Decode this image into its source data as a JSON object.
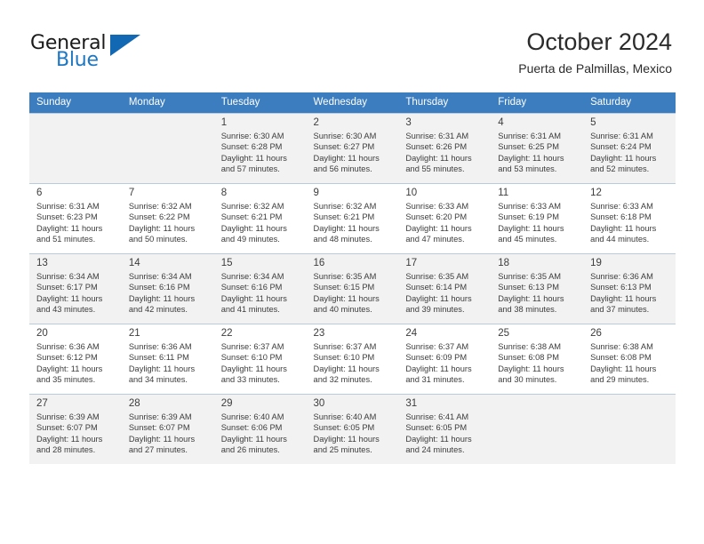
{
  "brand": {
    "name_part1": "General",
    "name_part2": "Blue",
    "triangle_color": "#1268b3",
    "blue_color": "#1f77c2"
  },
  "header": {
    "title": "October 2024",
    "subtitle": "Puerta de Palmillas, Mexico",
    "header_bg": "#3b7dbf",
    "header_text_color": "#ffffff"
  },
  "weekdays": [
    "Sunday",
    "Monday",
    "Tuesday",
    "Wednesday",
    "Thursday",
    "Friday",
    "Saturday"
  ],
  "weeks": [
    {
      "days": [
        {
          "day": "",
          "sunrise": "",
          "sunset": "",
          "daylight_line1": "",
          "daylight_line2": ""
        },
        {
          "day": "",
          "sunrise": "",
          "sunset": "",
          "daylight_line1": "",
          "daylight_line2": ""
        },
        {
          "day": "1",
          "sunrise": "Sunrise: 6:30 AM",
          "sunset": "Sunset: 6:28 PM",
          "daylight_line1": "Daylight: 11 hours",
          "daylight_line2": "and 57 minutes."
        },
        {
          "day": "2",
          "sunrise": "Sunrise: 6:30 AM",
          "sunset": "Sunset: 6:27 PM",
          "daylight_line1": "Daylight: 11 hours",
          "daylight_line2": "and 56 minutes."
        },
        {
          "day": "3",
          "sunrise": "Sunrise: 6:31 AM",
          "sunset": "Sunset: 6:26 PM",
          "daylight_line1": "Daylight: 11 hours",
          "daylight_line2": "and 55 minutes."
        },
        {
          "day": "4",
          "sunrise": "Sunrise: 6:31 AM",
          "sunset": "Sunset: 6:25 PM",
          "daylight_line1": "Daylight: 11 hours",
          "daylight_line2": "and 53 minutes."
        },
        {
          "day": "5",
          "sunrise": "Sunrise: 6:31 AM",
          "sunset": "Sunset: 6:24 PM",
          "daylight_line1": "Daylight: 11 hours",
          "daylight_line2": "and 52 minutes."
        }
      ]
    },
    {
      "days": [
        {
          "day": "6",
          "sunrise": "Sunrise: 6:31 AM",
          "sunset": "Sunset: 6:23 PM",
          "daylight_line1": "Daylight: 11 hours",
          "daylight_line2": "and 51 minutes."
        },
        {
          "day": "7",
          "sunrise": "Sunrise: 6:32 AM",
          "sunset": "Sunset: 6:22 PM",
          "daylight_line1": "Daylight: 11 hours",
          "daylight_line2": "and 50 minutes."
        },
        {
          "day": "8",
          "sunrise": "Sunrise: 6:32 AM",
          "sunset": "Sunset: 6:21 PM",
          "daylight_line1": "Daylight: 11 hours",
          "daylight_line2": "and 49 minutes."
        },
        {
          "day": "9",
          "sunrise": "Sunrise: 6:32 AM",
          "sunset": "Sunset: 6:21 PM",
          "daylight_line1": "Daylight: 11 hours",
          "daylight_line2": "and 48 minutes."
        },
        {
          "day": "10",
          "sunrise": "Sunrise: 6:33 AM",
          "sunset": "Sunset: 6:20 PM",
          "daylight_line1": "Daylight: 11 hours",
          "daylight_line2": "and 47 minutes."
        },
        {
          "day": "11",
          "sunrise": "Sunrise: 6:33 AM",
          "sunset": "Sunset: 6:19 PM",
          "daylight_line1": "Daylight: 11 hours",
          "daylight_line2": "and 45 minutes."
        },
        {
          "day": "12",
          "sunrise": "Sunrise: 6:33 AM",
          "sunset": "Sunset: 6:18 PM",
          "daylight_line1": "Daylight: 11 hours",
          "daylight_line2": "and 44 minutes."
        }
      ]
    },
    {
      "days": [
        {
          "day": "13",
          "sunrise": "Sunrise: 6:34 AM",
          "sunset": "Sunset: 6:17 PM",
          "daylight_line1": "Daylight: 11 hours",
          "daylight_line2": "and 43 minutes."
        },
        {
          "day": "14",
          "sunrise": "Sunrise: 6:34 AM",
          "sunset": "Sunset: 6:16 PM",
          "daylight_line1": "Daylight: 11 hours",
          "daylight_line2": "and 42 minutes."
        },
        {
          "day": "15",
          "sunrise": "Sunrise: 6:34 AM",
          "sunset": "Sunset: 6:16 PM",
          "daylight_line1": "Daylight: 11 hours",
          "daylight_line2": "and 41 minutes."
        },
        {
          "day": "16",
          "sunrise": "Sunrise: 6:35 AM",
          "sunset": "Sunset: 6:15 PM",
          "daylight_line1": "Daylight: 11 hours",
          "daylight_line2": "and 40 minutes."
        },
        {
          "day": "17",
          "sunrise": "Sunrise: 6:35 AM",
          "sunset": "Sunset: 6:14 PM",
          "daylight_line1": "Daylight: 11 hours",
          "daylight_line2": "and 39 minutes."
        },
        {
          "day": "18",
          "sunrise": "Sunrise: 6:35 AM",
          "sunset": "Sunset: 6:13 PM",
          "daylight_line1": "Daylight: 11 hours",
          "daylight_line2": "and 38 minutes."
        },
        {
          "day": "19",
          "sunrise": "Sunrise: 6:36 AM",
          "sunset": "Sunset: 6:13 PM",
          "daylight_line1": "Daylight: 11 hours",
          "daylight_line2": "and 37 minutes."
        }
      ]
    },
    {
      "days": [
        {
          "day": "20",
          "sunrise": "Sunrise: 6:36 AM",
          "sunset": "Sunset: 6:12 PM",
          "daylight_line1": "Daylight: 11 hours",
          "daylight_line2": "and 35 minutes."
        },
        {
          "day": "21",
          "sunrise": "Sunrise: 6:36 AM",
          "sunset": "Sunset: 6:11 PM",
          "daylight_line1": "Daylight: 11 hours",
          "daylight_line2": "and 34 minutes."
        },
        {
          "day": "22",
          "sunrise": "Sunrise: 6:37 AM",
          "sunset": "Sunset: 6:10 PM",
          "daylight_line1": "Daylight: 11 hours",
          "daylight_line2": "and 33 minutes."
        },
        {
          "day": "23",
          "sunrise": "Sunrise: 6:37 AM",
          "sunset": "Sunset: 6:10 PM",
          "daylight_line1": "Daylight: 11 hours",
          "daylight_line2": "and 32 minutes."
        },
        {
          "day": "24",
          "sunrise": "Sunrise: 6:37 AM",
          "sunset": "Sunset: 6:09 PM",
          "daylight_line1": "Daylight: 11 hours",
          "daylight_line2": "and 31 minutes."
        },
        {
          "day": "25",
          "sunrise": "Sunrise: 6:38 AM",
          "sunset": "Sunset: 6:08 PM",
          "daylight_line1": "Daylight: 11 hours",
          "daylight_line2": "and 30 minutes."
        },
        {
          "day": "26",
          "sunrise": "Sunrise: 6:38 AM",
          "sunset": "Sunset: 6:08 PM",
          "daylight_line1": "Daylight: 11 hours",
          "daylight_line2": "and 29 minutes."
        }
      ]
    },
    {
      "days": [
        {
          "day": "27",
          "sunrise": "Sunrise: 6:39 AM",
          "sunset": "Sunset: 6:07 PM",
          "daylight_line1": "Daylight: 11 hours",
          "daylight_line2": "and 28 minutes."
        },
        {
          "day": "28",
          "sunrise": "Sunrise: 6:39 AM",
          "sunset": "Sunset: 6:07 PM",
          "daylight_line1": "Daylight: 11 hours",
          "daylight_line2": "and 27 minutes."
        },
        {
          "day": "29",
          "sunrise": "Sunrise: 6:40 AM",
          "sunset": "Sunset: 6:06 PM",
          "daylight_line1": "Daylight: 11 hours",
          "daylight_line2": "and 26 minutes."
        },
        {
          "day": "30",
          "sunrise": "Sunrise: 6:40 AM",
          "sunset": "Sunset: 6:05 PM",
          "daylight_line1": "Daylight: 11 hours",
          "daylight_line2": "and 25 minutes."
        },
        {
          "day": "31",
          "sunrise": "Sunrise: 6:41 AM",
          "sunset": "Sunset: 6:05 PM",
          "daylight_line1": "Daylight: 11 hours",
          "daylight_line2": "and 24 minutes."
        },
        {
          "day": "",
          "sunrise": "",
          "sunset": "",
          "daylight_line1": "",
          "daylight_line2": ""
        },
        {
          "day": "",
          "sunrise": "",
          "sunset": "",
          "daylight_line1": "",
          "daylight_line2": ""
        }
      ]
    }
  ]
}
